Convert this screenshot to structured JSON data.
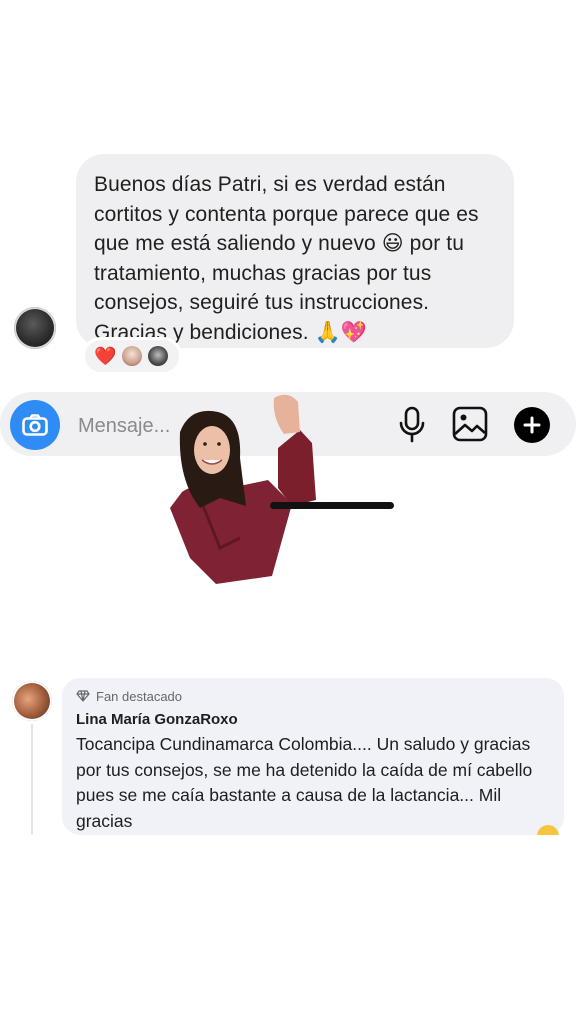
{
  "message": {
    "text": "Buenos días Patri, si es verdad están cortitos y contenta porque parece que es que me está saliendo y nuevo 😃 por tu tratamiento, muchas gracias por tus consejos, seguiré tus instrucciones. Gracias y bendiciones. 🙏💖",
    "reaction_emoji": "❤️"
  },
  "composer": {
    "placeholder": "Mensaje..."
  },
  "comment": {
    "badge_label": "Fan destacado",
    "author": "Lina María GonzaRoxo",
    "text": "Tocancipa Cundinamarca Colombia.... Un saludo y gracias por tus consejos, se me ha detenido la caída de mí cabello pues se me caía bastante a causa de la lactancia... Mil gracias"
  },
  "colors": {
    "camera_button": "#2f8cf5",
    "bubble_bg": "#efeff1",
    "comment_bg": "#f0f2f7",
    "heart": "#e0245e"
  },
  "icons": [
    "camera-icon",
    "microphone-icon",
    "gallery-icon",
    "plus-icon",
    "diamond-icon",
    "heart-icon"
  ]
}
